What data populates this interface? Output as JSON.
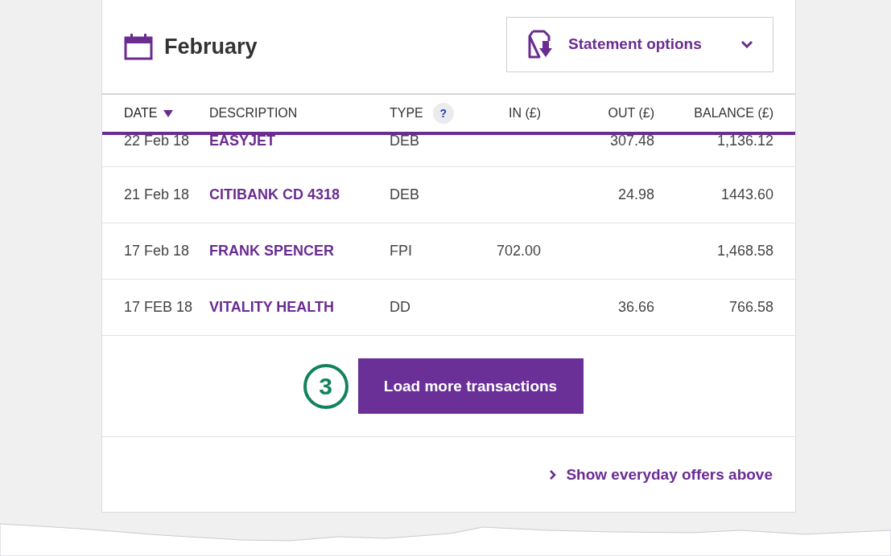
{
  "month": {
    "title": "February"
  },
  "statement_options": {
    "label": "Statement options"
  },
  "table": {
    "columns": [
      {
        "label": "DATE",
        "sorted": true
      },
      {
        "label": "DESCRIPTION",
        "sorted": false
      },
      {
        "label": "TYPE",
        "sorted": false,
        "help": "?"
      },
      {
        "label": "IN (£)",
        "sorted": false
      },
      {
        "label": "OUT (£)",
        "sorted": false
      },
      {
        "label": "BALANCE (£)",
        "sorted": false
      }
    ],
    "rows": [
      {
        "date": "22 Feb 18",
        "description": "EASYJET",
        "type": "DEB",
        "out": "307.48",
        "balance": "1,136.12",
        "partly_hidden": true
      },
      {
        "date": "21 Feb 18",
        "description": "CITIBANK CD 4318",
        "type": "DEB",
        "out": "24.98",
        "balance": "1443.60",
        "partly_hidden": false
      },
      {
        "date": "17 Feb 18",
        "description": "FRANK SPENCER",
        "type": "FPI",
        "in": "702.00",
        "balance": "1,468.58",
        "partly_hidden": false
      },
      {
        "date": "17 FEB 18",
        "description": "VITALITY HEALTH",
        "type": "DD",
        "out": "36.66",
        "balance": "766.58",
        "partly_hidden": false
      }
    ]
  },
  "step_marker": "3",
  "load_more": {
    "label": "Load more transactions"
  },
  "offers_link": {
    "label": "Show everyday offers above"
  }
}
